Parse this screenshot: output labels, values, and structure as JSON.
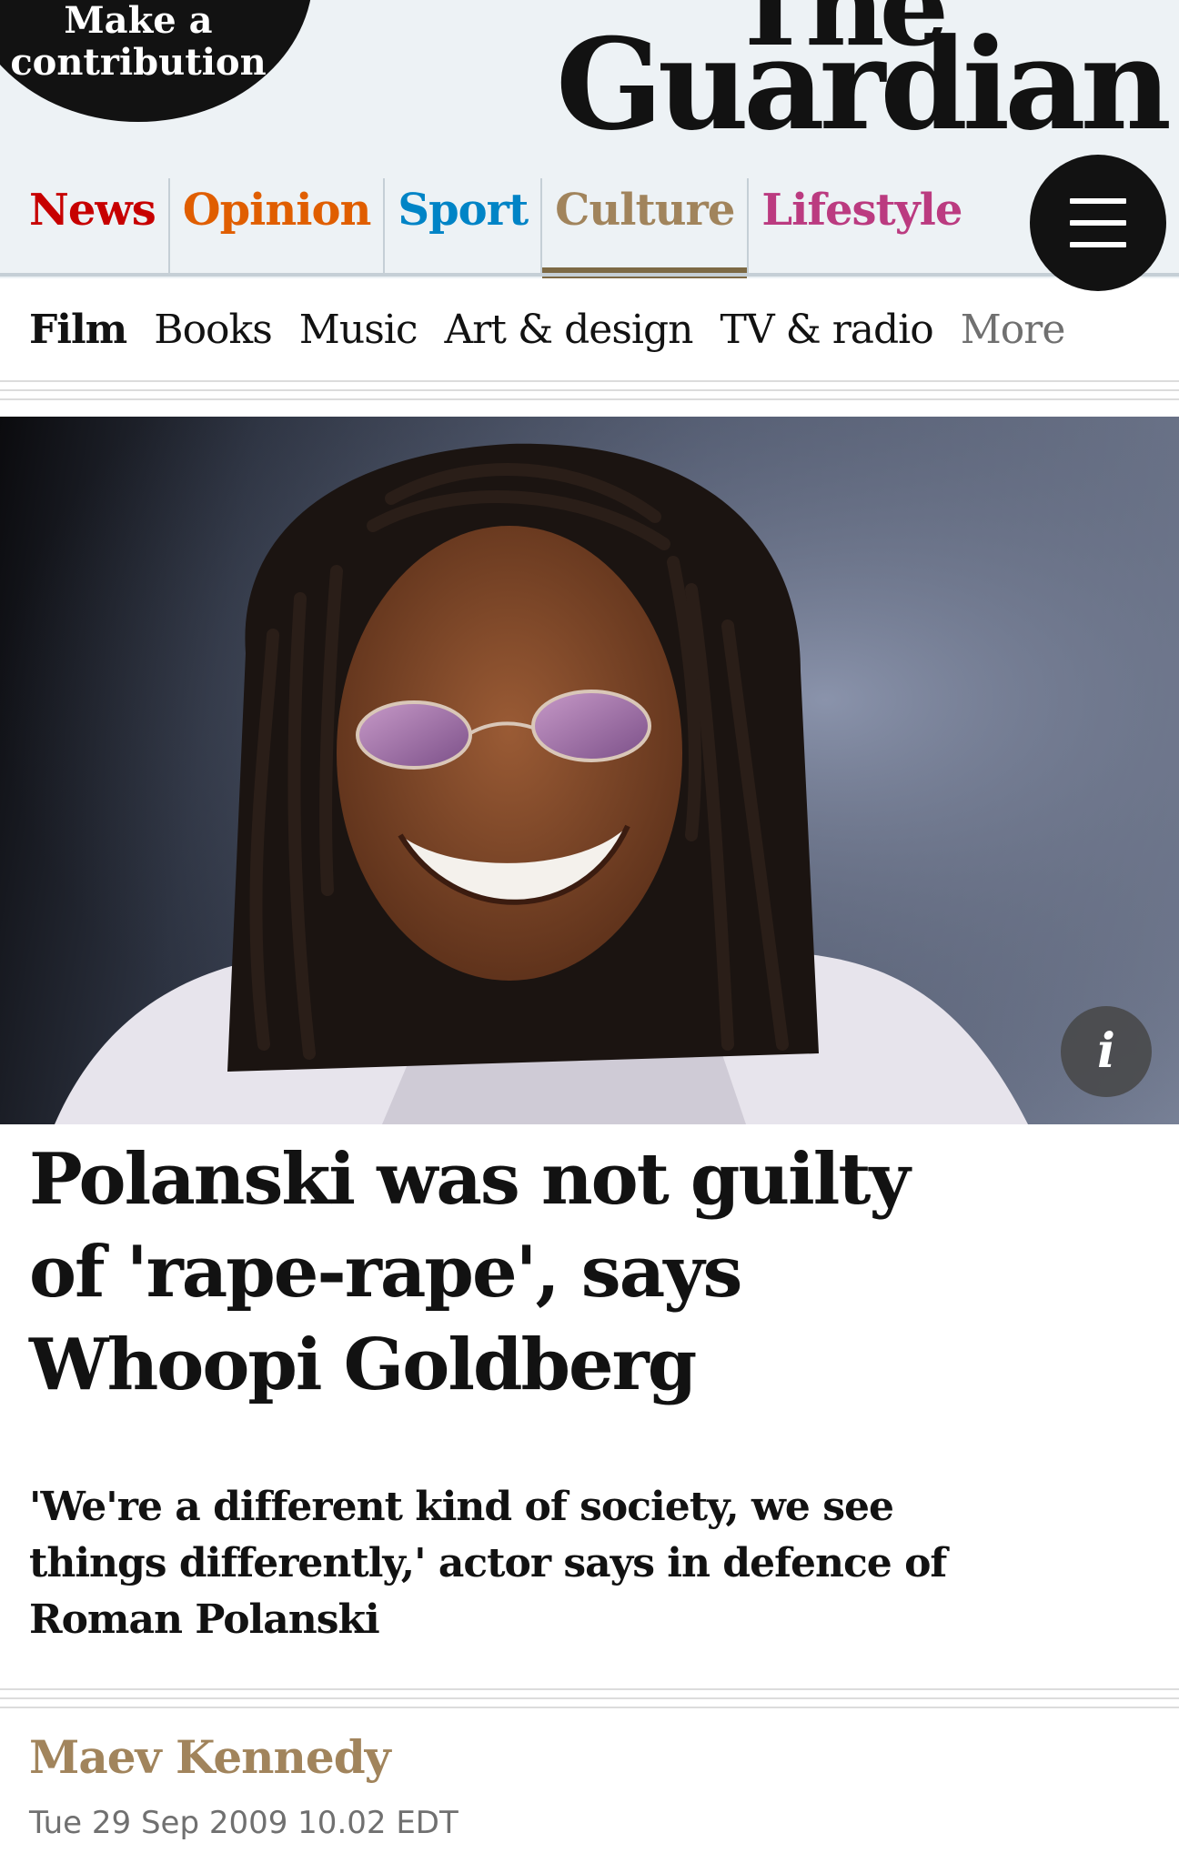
{
  "header": {
    "contribute": {
      "line1": "Make a",
      "line2": "contribution"
    },
    "logo": {
      "line1": "The",
      "line2": "Guardian"
    },
    "pillars": [
      {
        "label": "News",
        "color": "#c70000"
      },
      {
        "label": "Opinion",
        "color": "#e05e00"
      },
      {
        "label": "Sport",
        "color": "#0084c6"
      },
      {
        "label": "Culture",
        "color": "#a1845c",
        "active": true
      },
      {
        "label": "Lifestyle",
        "color": "#bb3b80"
      }
    ],
    "menu_icon": "hamburger-menu-icon"
  },
  "subnav": {
    "items": [
      "Film",
      "Books",
      "Music",
      "Art & design",
      "TV & radio"
    ],
    "current": "Film",
    "more": "More"
  },
  "hero": {
    "info_label": "i",
    "info_icon": "info-icon"
  },
  "article": {
    "headline": "Polanski was not guilty of 'rape-rape', says Whoopi Goldberg",
    "standfirst": "'We're a different kind of society, we see things differently,' actor says in defence of Roman Polanski",
    "byline": "Maev Kennedy",
    "date": "Tue 29 Sep 2009 10.02 EDT"
  },
  "colors": {
    "header_bg": "#edf2f5",
    "culture_accent": "#a1845c",
    "culture_underline": "#7d6a45",
    "text": "#121212"
  }
}
